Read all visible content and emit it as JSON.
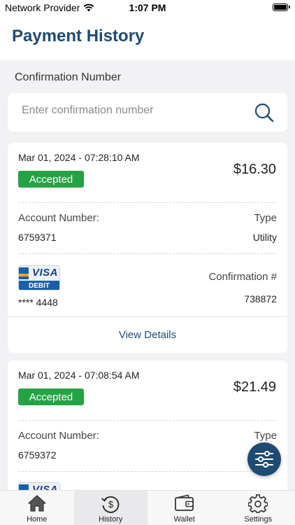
{
  "status_bar": {
    "carrier": "Network Provider",
    "time": "1:07 PM"
  },
  "header": {
    "title": "Payment History"
  },
  "search": {
    "label": "Confirmation Number",
    "placeholder": "Enter confirmation number",
    "value": ""
  },
  "payments": [
    {
      "datetime": "Mar 01, 2024 - 07:28:10 AM",
      "status": "Accepted",
      "amount": "$16.30",
      "account_label": "Account Number:",
      "account_number": "6759371",
      "type_label": "Type",
      "type_value": "Utility",
      "card_brand": "VISA",
      "card_kind": "DEBIT",
      "card_number": "**** 4448",
      "confirmation_label": "Confirmation #",
      "confirmation_number": "738872",
      "view_details": "View Details"
    },
    {
      "datetime": "Mar 01, 2024 - 07:08:54 AM",
      "status": "Accepted",
      "amount": "$21.49",
      "account_label": "Account Number:",
      "account_number": "6759372",
      "type_label": "Type",
      "card_brand": "VISA"
    }
  ],
  "tabs": [
    {
      "label": "Home",
      "icon": "home-icon"
    },
    {
      "label": "History",
      "icon": "history-dollar-icon",
      "active": true
    },
    {
      "label": "Wallet",
      "icon": "wallet-icon"
    },
    {
      "label": "Settings",
      "icon": "gear-icon"
    }
  ],
  "colors": {
    "brand": "#1f4b72",
    "accepted": "#25a244",
    "background": "#f2f2f5"
  }
}
